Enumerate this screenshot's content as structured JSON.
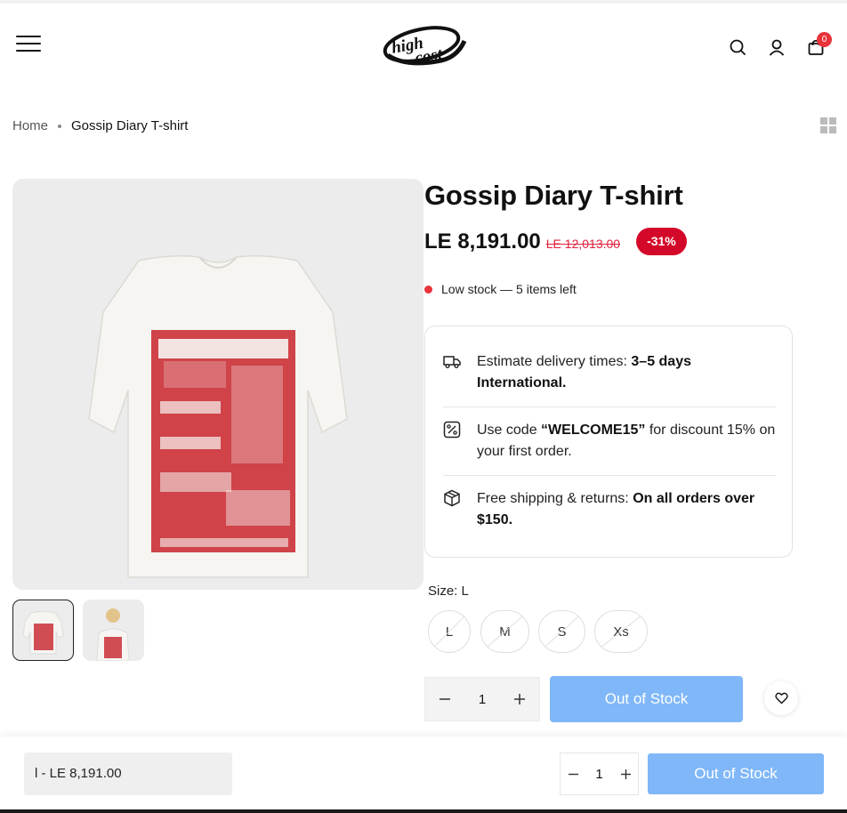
{
  "header": {
    "logo_alt": "high cost",
    "cart_count": "0"
  },
  "breadcrumb": {
    "home": "Home",
    "current": "Gossip Diary T-shirt"
  },
  "product": {
    "title": "Gossip Diary T-shirt",
    "price": "LE 8,191.00",
    "compare_price": "LE 12,013.00",
    "discount": "-31%",
    "stock_text": "Low stock — 5 items left",
    "stock_color": "#e8333a"
  },
  "info": {
    "delivery_prefix": "Estimate delivery times: ",
    "delivery_bold": "3–5 days International.",
    "code_prefix": "Use code ",
    "code_bold": "“WELCOME15”",
    "code_suffix": " for discount 15% on your first order.",
    "shipping_prefix": "Free shipping & returns: ",
    "shipping_bold": "On all orders over $150."
  },
  "size": {
    "label": "Size: ",
    "selected": "L",
    "options": [
      "L",
      "M",
      "S",
      "Xs"
    ]
  },
  "purchase": {
    "quantity": "1",
    "button_label": "Out of Stock",
    "button_color": "#7fb7f8"
  },
  "sticky": {
    "variant_label": "l - LE 8,191.00",
    "quantity": "1",
    "button_label": "Out of Stock"
  },
  "icons": {
    "menu": "hamburger-menu-icon",
    "search": "search-icon",
    "account": "user-icon",
    "cart": "shopping-bag-icon",
    "delivery": "truck-icon",
    "discount": "percent-icon",
    "shipping": "box-icon",
    "wishlist": "heart-icon",
    "layout": "grid-layout-icon"
  }
}
